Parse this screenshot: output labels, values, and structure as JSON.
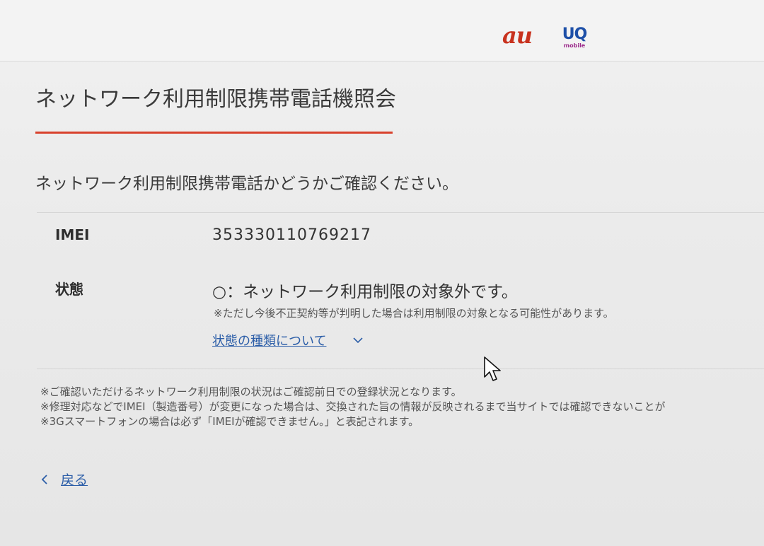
{
  "header": {
    "logo_au": "au",
    "logo_uq": "UQ",
    "logo_uq_sub": "mobile"
  },
  "page": {
    "title": "ネットワーク利用制限携帯電話機照会",
    "instruction": "ネットワーク利用制限携帯電話かどうかご確認ください。"
  },
  "result": {
    "imei_label": "IMEI",
    "imei_value": "353330110769217",
    "status_label": "状態",
    "status_value": "○：ネットワーク利用制限の対象外です。",
    "status_note": "※ただし今後不正契約等が判明した場合は利用制限の対象となる可能性があります。",
    "status_link": "状態の種類について"
  },
  "notes": [
    "※ご確認いただけるネットワーク利用制限の状況はご確認前日での登録状況となります。",
    "※修理対応などでIMEI（製造番号）が変更になった場合は、交換された旨の情報が反映されるまで当サイトでは確認できないことが",
    "※3Gスマートフォンの場合は必ず「IMEIが確認できません。」と表記されます。"
  ],
  "nav": {
    "back_label": "戻る"
  },
  "icons": {
    "chevron_down": "chevron-down-icon",
    "chevron_left": "chevron-left-icon",
    "cursor": "mouse-cursor-icon"
  },
  "colors": {
    "accent_red": "#d8412c",
    "link_blue": "#2c5ea8",
    "au_orange": "#c8321e",
    "uq_blue": "#1e50a8"
  }
}
